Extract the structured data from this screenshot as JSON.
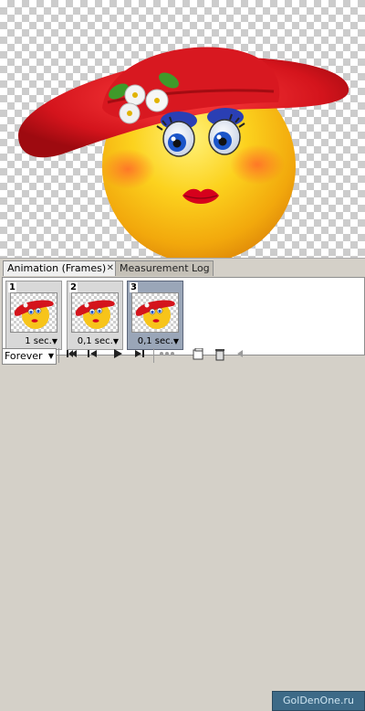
{
  "tabs": {
    "animation_label": "Animation (Frames)",
    "close_glyph": "✕",
    "measurement_label": "Measurement Log"
  },
  "frames": [
    {
      "number": "1",
      "delay": "1 sec.",
      "selected": false
    },
    {
      "number": "2",
      "delay": "0,1 sec.",
      "selected": false
    },
    {
      "number": "3",
      "delay": "0,1 sec.",
      "selected": true
    }
  ],
  "controls": {
    "loop_value": "Forever",
    "select_arrow": "▼",
    "first_frame_icon": "first-frame-icon",
    "prev_frame_icon": "previous-frame-icon",
    "play_icon": "play-icon",
    "next_frame_icon": "next-frame-icon",
    "tween_icon": "tween-icon",
    "duplicate_icon": "duplicate-frame-icon",
    "delete_icon": "trash-icon"
  },
  "watermark": "GolDenOne.ru",
  "colors": {
    "hat": "#d4141c",
    "face": "#f7c41a",
    "eyes": "#1b55c9",
    "lips": "#d6001c"
  }
}
